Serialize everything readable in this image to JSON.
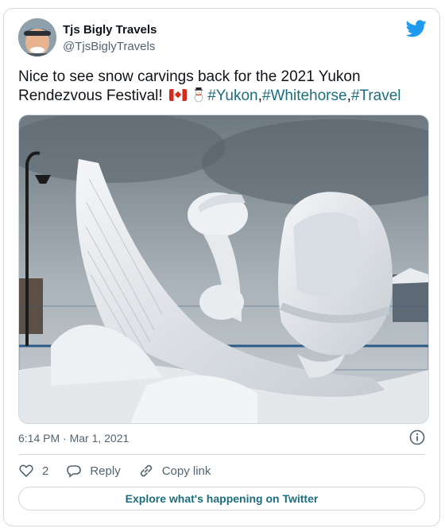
{
  "author": {
    "name": "Tjs Bigly Travels",
    "handle": "@TjsBiglyTravels"
  },
  "tweet": {
    "text": "Nice to see snow carvings back for the 2021 Yukon Rendezvous Festival!",
    "emojis": [
      "canada-flag",
      "snowman"
    ],
    "hashtags": [
      "#Yukon",
      "#Whitehorse",
      "#Travel"
    ],
    "separator": ","
  },
  "timestamp": "6:14 PM · Mar 1, 2021",
  "actions": {
    "like_count": "2",
    "reply_label": "Reply",
    "copy_link_label": "Copy link"
  },
  "explore_label": "Explore what's happening on Twitter",
  "colors": {
    "link": "#1d6d7e",
    "twitter_blue": "#1d9bf0",
    "muted": "#536471"
  }
}
